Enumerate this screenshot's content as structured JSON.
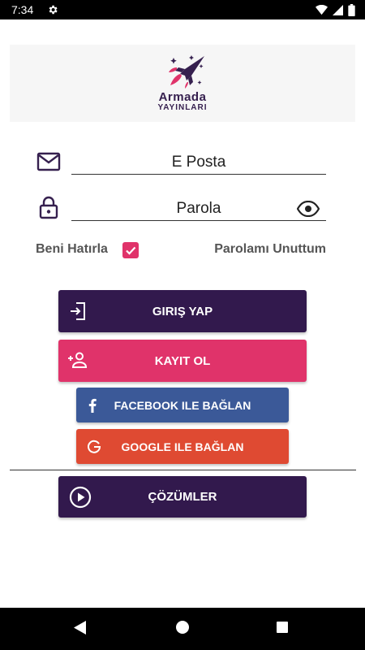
{
  "status_bar": {
    "time": "7:34",
    "icons": [
      "settings-icon",
      "wifi-icon",
      "signal-icon",
      "battery-icon"
    ]
  },
  "logo": {
    "line1": "Armada",
    "line2": "YAYINLARI"
  },
  "form": {
    "email_placeholder": "E Posta",
    "password_placeholder": "Parola",
    "remember_label": "Beni Hatırla",
    "remember_checked": true,
    "forgot_label": "Parolamı Unuttum"
  },
  "buttons": {
    "login": "GIRIŞ YAP",
    "register": "KAYIT OL",
    "facebook": "FACEBOOK ILE BAĞLAN",
    "google": "GOOGLE ILE BAĞLAN",
    "solutions": "ÇÖZÜMLER"
  },
  "colors": {
    "primary": "#32194d",
    "accent": "#e0336a",
    "facebook": "#3b5998",
    "google": "#df4a32"
  }
}
